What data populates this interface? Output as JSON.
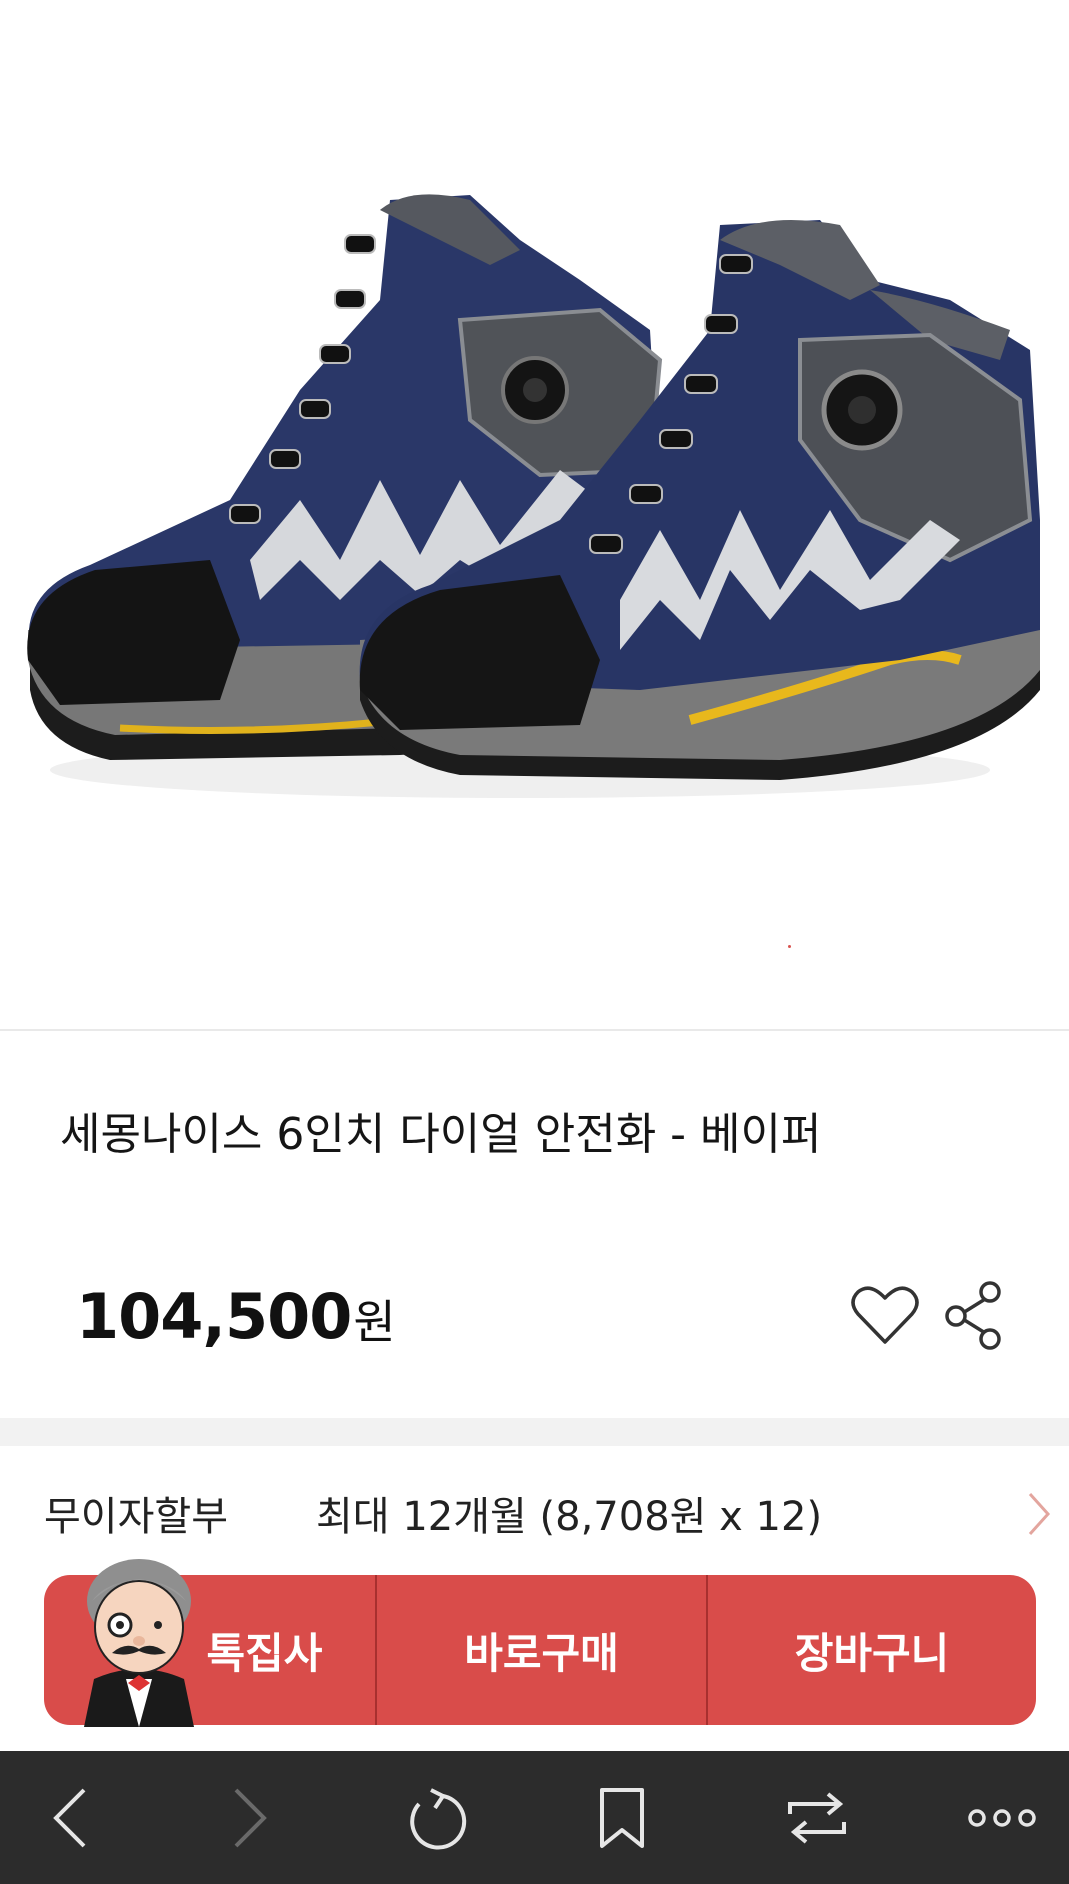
{
  "product": {
    "title": "세몽나이스 6인치 다이얼 안전화 - 베이퍼",
    "price": "104,500",
    "price_unit": "원"
  },
  "installment": {
    "label": "무이자할부",
    "value": "최대 12개월 (8,708원 x 12)"
  },
  "actions": {
    "special": "톡집사",
    "buy_now": "바로구매",
    "cart": "장바구니"
  },
  "colors": {
    "accent": "#d94c4a",
    "navbar": "#2c2c2c"
  },
  "icons": {
    "wishlist": "heart-outline-icon",
    "share": "share-icon",
    "back": "chevron-left-icon",
    "forward": "chevron-right-icon",
    "refresh": "refresh-icon",
    "bookmark": "bookmark-icon",
    "tabs": "switch-tabs-icon",
    "more": "more-dots-icon"
  }
}
